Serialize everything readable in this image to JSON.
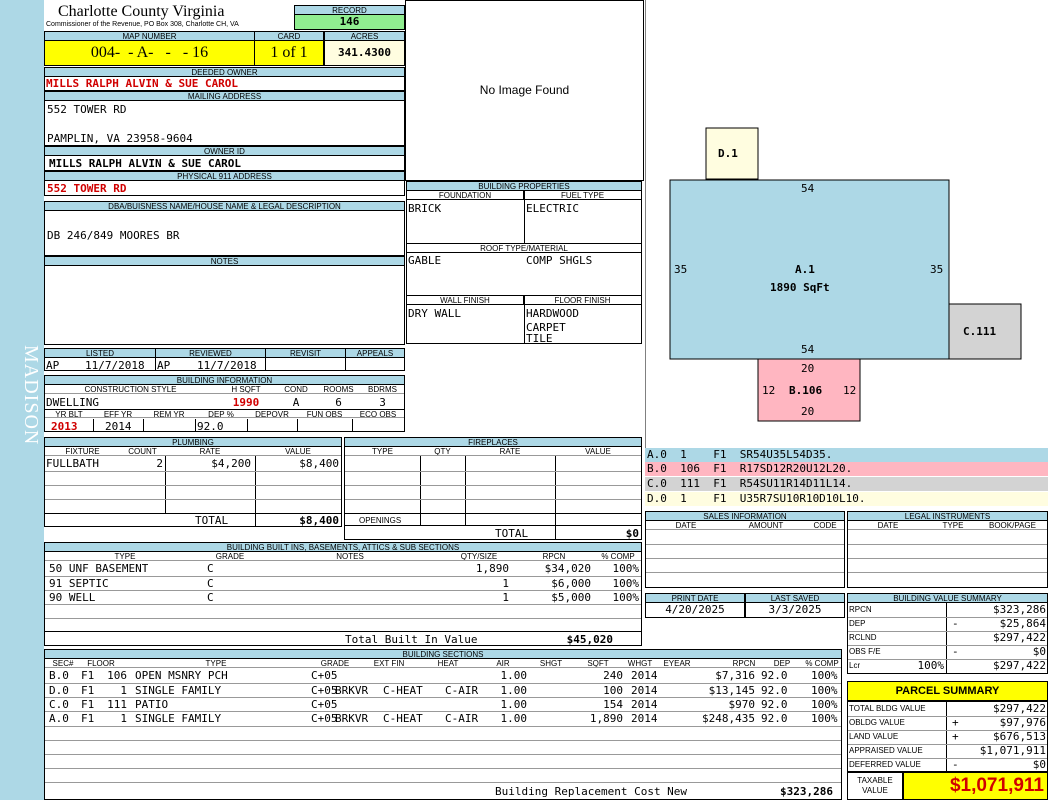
{
  "sidebar": {
    "label": "MADISON"
  },
  "header": {
    "county": "Charlotte County Virginia",
    "commissioner": "Commissioner of the Revenue, PO Box 308, Charlotte CH, VA",
    "record_label": "RECORD",
    "record_value": "146"
  },
  "parcel": {
    "map_label": "MAP NUMBER",
    "map_value": "004-  - A-   -   - 16",
    "card_label": "CARD",
    "card_value": "1 of 1",
    "acres_label": "ACRES",
    "acres_value": "341.4300"
  },
  "owner": {
    "deeded_label": "DEEDED OWNER",
    "deeded_value": "MILLS RALPH ALVIN & SUE CAROL",
    "mailing_label": "MAILING ADDRESS",
    "mailing_line1": "552 TOWER RD",
    "mailing_line2": "PAMPLIN, VA 23958-9604",
    "owner_id_label": "OWNER ID",
    "owner_id_value": "MILLS RALPH ALVIN & SUE CAROL",
    "physical_label": "PHYSICAL 911 ADDRESS",
    "physical_value": "552 TOWER RD",
    "dba_label": "DBA/BUISNESS NAME/HOUSE NAME & LEGAL DESCRIPTION",
    "dba_value": "DB 246/849 MOORES BR",
    "notes_label": "NOTES"
  },
  "image": {
    "placeholder": "No Image Found"
  },
  "listing": {
    "listed_label": "LISTED",
    "reviewed_label": "REVIEWED",
    "revisit_label": "REVISIT",
    "appeals_label": "APPEALS",
    "listed_by": "AP",
    "listed_date": "11/7/2018",
    "reviewed_by": "AP",
    "reviewed_date": "11/7/2018"
  },
  "building_info": {
    "title": "BUILDING INFORMATION",
    "h_construction": "CONSTRUCTION STYLE",
    "h_hsqft": "H SQFT",
    "h_cond": "COND",
    "h_rooms": "ROOMS",
    "h_bdrms": "BDRMS",
    "construction": "DWELLING",
    "hsqft": "1990",
    "cond": "A",
    "rooms": "6",
    "bdrms": "3",
    "h_yrblt": "YR BLT",
    "h_effyr": "EFF YR",
    "h_remyr": "REM YR",
    "h_dep": "DEP %",
    "h_depovr": "DEPOVR",
    "h_funobs": "FUN OBS",
    "h_ecoobs": "ECO OBS",
    "yrblt": "2013",
    "effyr": "2014",
    "dep": "92.0"
  },
  "building_props": {
    "title": "BUILDING PROPERTIES",
    "foundation_label": "FOUNDATION",
    "fuel_label": "FUEL TYPE",
    "foundation": "BRICK",
    "fuel": "ELECTRIC",
    "roof_label": "ROOF TYPE/MATERIAL",
    "roof_type": "GABLE",
    "roof_material": "COMP SHGLS",
    "wall_label": "WALL FINISH",
    "floor_label": "FLOOR FINISH",
    "wall": "DRY WALL",
    "floor1": "HARDWOOD",
    "floor2": "CARPET",
    "floor3": "TILE"
  },
  "plumbing": {
    "title": "PLUMBING",
    "h_fixture": "FIXTURE",
    "h_count": "COUNT",
    "h_rate": "RATE",
    "h_value": "VALUE",
    "fixture": "FULLBATH",
    "count": "2",
    "rate": "$4,200",
    "value": "$8,400",
    "total_label": "TOTAL",
    "total": "$8,400"
  },
  "fireplaces": {
    "title": "FIREPLACES",
    "h_type": "TYPE",
    "h_qty": "QTY",
    "h_rate": "RATE",
    "h_value": "VALUE",
    "openings_label": "OPENINGS",
    "total_label": "TOTAL",
    "total": "$0"
  },
  "builtins": {
    "title": "BUILDING BUILT INS, BASEMENTS, ATTICS & SUB SECTIONS",
    "h_type": "TYPE",
    "h_grade": "GRADE",
    "h_notes": "NOTES",
    "h_qty": "QTY/SIZE",
    "h_rpcn": "RPCN",
    "h_comp": "% COMP",
    "rows": [
      {
        "type": "50 UNF BASEMENT",
        "grade": "C",
        "qty": "1,890",
        "rpcn": "$34,020",
        "comp": "100%"
      },
      {
        "type": "91 SEPTIC",
        "grade": "C",
        "qty": "1",
        "rpcn": "$6,000",
        "comp": "100%"
      },
      {
        "type": "90 WELL",
        "grade": "C",
        "qty": "1",
        "rpcn": "$5,000",
        "comp": "100%"
      }
    ],
    "total_label": "Total Built In Value",
    "total": "$45,020"
  },
  "sections": {
    "title": "BUILDING SECTIONS",
    "h_sec": "SEC#",
    "h_floor": "FLOOR",
    "h_type": "TYPE",
    "h_grade": "GRADE",
    "h_extfin": "EXT FIN",
    "h_heat": "HEAT",
    "h_air": "AIR",
    "h_shgt": "SHGT",
    "h_sqft": "SQFT",
    "h_whgt": "WHGT",
    "h_eyear": "EYEAR",
    "h_rpcn": "RPCN",
    "h_dep": "DEP",
    "h_comp": "% COMP",
    "rows": [
      {
        "sec": "B.0",
        "floor": "F1",
        "code": "106",
        "type": "OPEN MSNRY PCH",
        "grade": "C+05",
        "extfin": "",
        "heat": "",
        "air": "",
        "shgt": "1.00",
        "sqft": "240",
        "eyear": "2014",
        "rpcn": "$7,316",
        "dep": "92.0",
        "comp": "100%"
      },
      {
        "sec": "D.0",
        "floor": "F1",
        "code": "1",
        "type": "SINGLE FAMILY",
        "grade": "C+05",
        "extfin": "BRKVR",
        "heat": "C-HEAT",
        "air": "C-AIR",
        "shgt": "1.00",
        "sqft": "100",
        "eyear": "2014",
        "rpcn": "$13,145",
        "dep": "92.0",
        "comp": "100%"
      },
      {
        "sec": "C.0",
        "floor": "F1",
        "code": "111",
        "type": "PATIO",
        "grade": "C+05",
        "extfin": "",
        "heat": "",
        "air": "",
        "shgt": "1.00",
        "sqft": "154",
        "eyear": "2014",
        "rpcn": "$970",
        "dep": "92.0",
        "comp": "100%"
      },
      {
        "sec": "A.0",
        "floor": "F1",
        "code": "1",
        "type": "SINGLE FAMILY",
        "grade": "C+05",
        "extfin": "BRKVR",
        "heat": "C-HEAT",
        "air": "C-AIR",
        "shgt": "1.00",
        "sqft": "1,890",
        "eyear": "2014",
        "rpcn": "$248,435",
        "dep": "92.0",
        "comp": "100%"
      }
    ],
    "total_label": "Building Replacement Cost New",
    "total": "$323,286"
  },
  "sketch": {
    "a_label": "A.1",
    "a_area": "1890 SqFt",
    "a_top": "54",
    "a_bottom": "54",
    "a_left": "35",
    "a_right": "35",
    "b_label": "B.106",
    "b_top": "20",
    "b_bottom": "20",
    "b_left": "12",
    "b_right": "12",
    "c_label": "C.111",
    "d_label": "D.1",
    "colors": {
      "a": "#add8e6",
      "b": "#ffb6c1",
      "c": "#d3d3d3",
      "d": "#fffde0"
    }
  },
  "legend": [
    {
      "text": "A.0  1    F1  SR54U35L54D35.",
      "color": "#add8e6"
    },
    {
      "text": "B.0  106  F1  R17SD12R20U12L20.",
      "color": "#ffb6c1"
    },
    {
      "text": "C.0  111  F1  R54SU11R14D11L14.",
      "color": "#d3d3d3"
    },
    {
      "text": "D.0  1    F1  U35R7SU10R10D10L10.",
      "color": "#fffde0"
    }
  ],
  "sales": {
    "title": "SALES INFORMATION",
    "h_date": "DATE",
    "h_amount": "AMOUNT",
    "h_code": "CODE"
  },
  "legal": {
    "title": "LEGAL INSTRUMENTS",
    "h_date": "DATE",
    "h_type": "TYPE",
    "h_book": "BOOK/PAGE"
  },
  "dates": {
    "print_label": "PRINT DATE",
    "print_value": "4/20/2025",
    "saved_label": "LAST SAVED",
    "saved_value": "3/3/2025"
  },
  "value_summary": {
    "title": "BUILDING VALUE SUMMARY",
    "rows": [
      {
        "label": "RPCN",
        "sign": "",
        "value": "$323,286"
      },
      {
        "label": "DEP",
        "sign": "-",
        "value": "$25,864"
      },
      {
        "label": "RCLND",
        "sign": "",
        "value": "$297,422"
      },
      {
        "label": "OBS F/E",
        "sign": "-",
        "value": "$0"
      },
      {
        "label": "Lcr",
        "pct": "100%",
        "sign": "",
        "value": "$297,422"
      }
    ]
  },
  "parcel_summary": {
    "title": "PARCEL SUMMARY",
    "rows": [
      {
        "label": "TOTAL BLDG VALUE",
        "sign": "",
        "value": "$297,422"
      },
      {
        "label": "OBLDG VALUE",
        "sign": "+",
        "value": "$97,976"
      },
      {
        "label": "LAND VALUE",
        "sign": "+",
        "value": "$676,513"
      },
      {
        "label": "APPRAISED VALUE",
        "sign": "",
        "value": "$1,071,911"
      },
      {
        "label": "DEFERRED VALUE",
        "sign": "-",
        "value": "$0"
      }
    ],
    "taxable_label1": "TAXABLE",
    "taxable_label2": "VALUE",
    "taxable_value": "$1,071,911"
  }
}
